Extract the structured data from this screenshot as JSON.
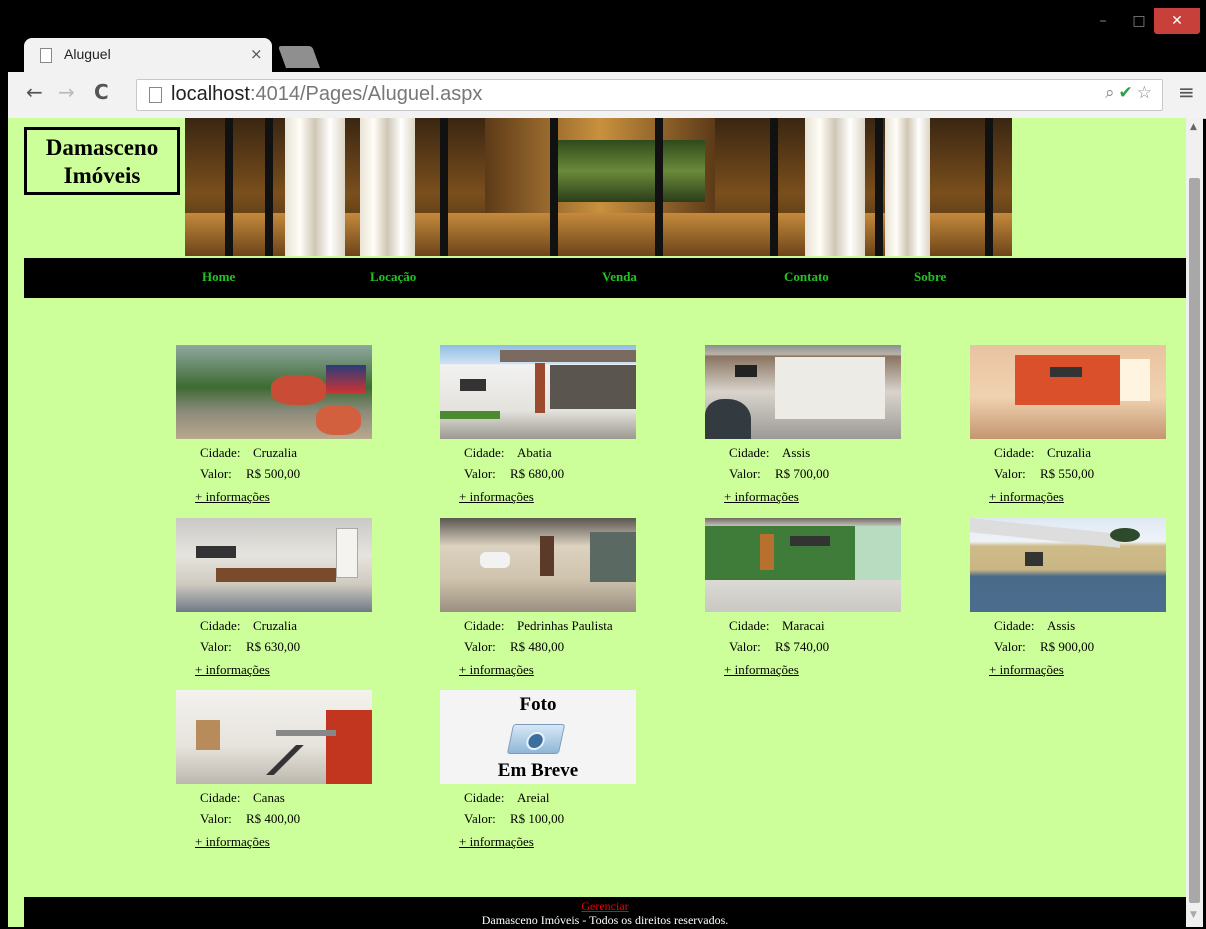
{
  "browser": {
    "tab_title": "Aluguel",
    "tab_close": "×",
    "url_host": "localhost",
    "url_rest": ":4014/Pages/Aluguel.aspx",
    "win_min": "–",
    "win_max": "□",
    "win_close": "✕",
    "back": "←",
    "forward": "→",
    "reload": "C",
    "menu": "≡",
    "omni_icons": {
      "zoom": "⌕",
      "ok": "✔",
      "star": "☆"
    }
  },
  "site": {
    "logo_line1": "Damasceno",
    "logo_line2": "Imóveis",
    "menu": [
      "Home",
      "Locação",
      "Venda",
      "Contato",
      "Sobre"
    ]
  },
  "listing": {
    "city_label": "Cidade:",
    "value_label": "Valor:",
    "more_label": "+ informações",
    "items": [
      {
        "city": "Cruzalia",
        "value": "R$ 500,00"
      },
      {
        "city": "Abatia",
        "value": "R$ 680,00"
      },
      {
        "city": "Assis",
        "value": "R$ 700,00"
      },
      {
        "city": "Cruzalia",
        "value": "R$ 550,00"
      },
      {
        "city": "Cruzalia",
        "value": "R$ 630,00"
      },
      {
        "city": "Pedrinhas Paulista",
        "value": "R$ 480,00"
      },
      {
        "city": "Maracai",
        "value": "R$ 740,00"
      },
      {
        "city": "Assis",
        "value": "R$ 900,00"
      },
      {
        "city": "Canas",
        "value": "R$ 400,00"
      },
      {
        "city": "Areial",
        "value": "R$ 100,00"
      }
    ],
    "placeholder_top": "Foto",
    "placeholder_bottom": "Em Breve"
  },
  "footer": {
    "manage": "Gerenciar",
    "copyright": "Damasceno Imóveis - Todos os direitos reservados."
  },
  "colors": {
    "page_bg": "#ccff99",
    "menu_text": "#22c322",
    "footer_link": "#e00000"
  }
}
